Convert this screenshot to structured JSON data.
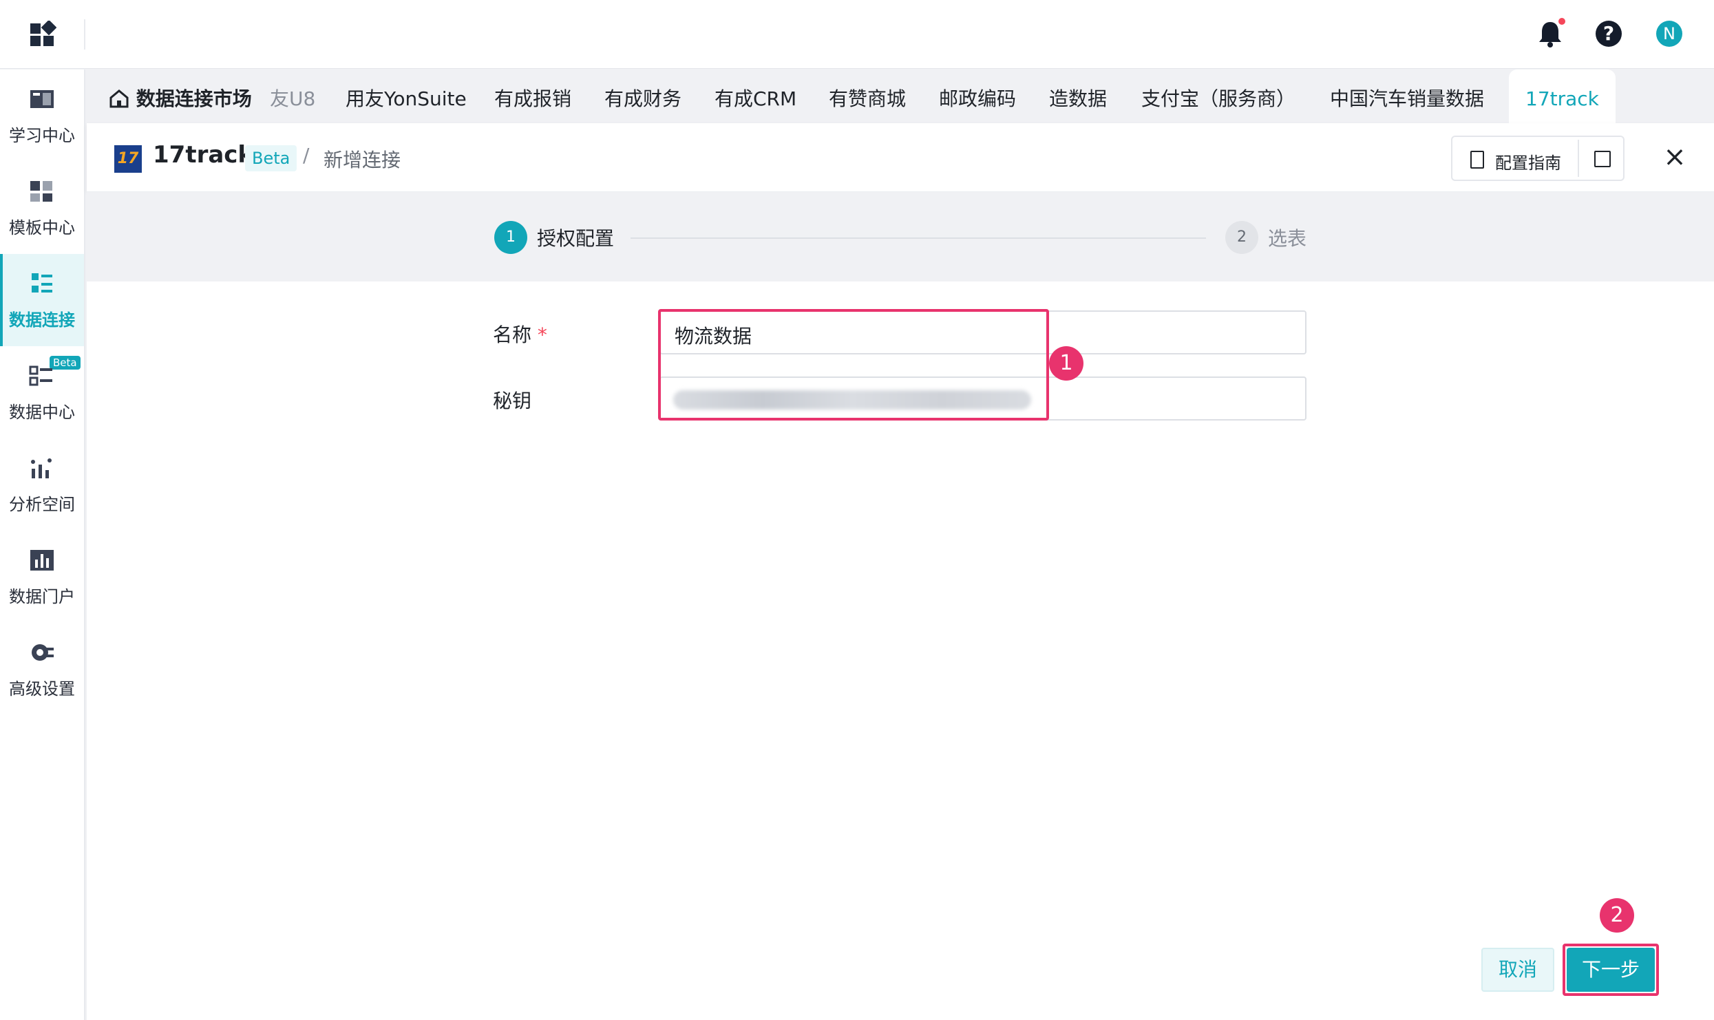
{
  "topbar": {
    "avatar_letter": "N"
  },
  "sidebar": {
    "items": [
      {
        "label": "学习中心",
        "icon": "book-icon"
      },
      {
        "label": "模板中心",
        "icon": "template-icon"
      },
      {
        "label": "数据连接",
        "icon": "data-connection-icon"
      },
      {
        "label": "数据中心",
        "icon": "data-center-icon",
        "badge": "Beta"
      },
      {
        "label": "分析空间",
        "icon": "analysis-icon"
      },
      {
        "label": "数据门户",
        "icon": "portal-icon"
      },
      {
        "label": "高级设置",
        "icon": "gear-icon"
      }
    ]
  },
  "tabs": {
    "home": "数据连接市场",
    "items": [
      "友U8",
      "用友YonSuite",
      "有成报销",
      "有成财务",
      "有成CRM",
      "有赞商城",
      "邮政编码",
      "造数据",
      "支付宝（服务商）",
      "中国汽车销量数据"
    ],
    "active": "17track"
  },
  "header": {
    "logo_text": "17",
    "title": "17track",
    "beta": "Beta",
    "separator": "/",
    "breadcrumb": "新增连接",
    "guide_label": "配置指南",
    "close": "×"
  },
  "steps": [
    {
      "number": "1",
      "label": "授权配置"
    },
    {
      "number": "2",
      "label": "选表"
    }
  ],
  "form": {
    "name_label": "名称",
    "required_mark": "*",
    "name_value": "物流数据",
    "key_label": "秘钥"
  },
  "annotations": {
    "badge1": "1",
    "badge2": "2"
  },
  "buttons": {
    "cancel": "取消",
    "next": "下一步"
  },
  "colors": {
    "accent": "#12a6b8",
    "highlight": "#e8336d"
  }
}
